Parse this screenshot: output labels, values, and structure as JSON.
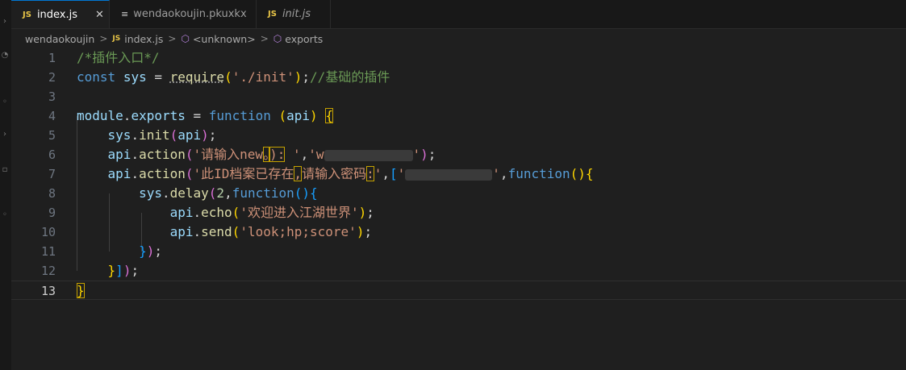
{
  "tabs": [
    {
      "label": "index.js",
      "badge": "JS",
      "active": true,
      "close": "✕"
    },
    {
      "label": "wendaokoujin.pkuxkx",
      "icon": "lines-file-icon"
    },
    {
      "label": "init.js",
      "badge": "JS",
      "italic": true
    }
  ],
  "breadcrumb": {
    "folder": "wendaokoujin",
    "file": "index.js",
    "file_badge": "JS",
    "symbol1": "<unknown>",
    "symbol2": "exports",
    "separator": ">"
  },
  "line_numbers": [
    "1",
    "2",
    "3",
    "4",
    "5",
    "6",
    "7",
    "8",
    "9",
    "10",
    "11",
    "12",
    "13"
  ],
  "code": {
    "l1_comment": "/*插件入口*/",
    "l2_const": "const",
    "l2_sys": "sys",
    "l2_eq": " = ",
    "l2_require": "require",
    "l2_str": "'./init'",
    "l2_semi": ";",
    "l2_comment": "//基础的插件",
    "l4_module": "module",
    "l4_dot": ".",
    "l4_exports": "exports",
    "l4_eq": " = ",
    "l4_function": "function",
    "l4_api": "api",
    "l5_sys": "sys",
    "l5_init": "init",
    "l5_api": "api",
    "l6_api": "api",
    "l6_action": "action",
    "l6_str_a": "'请输入new",
    "l6_str_b": "。",
    "l6_str_c": "):",
    "l6_str_d": " '",
    "l6_str_e": "'w",
    "l6_str_f": "'",
    "l7_api": "api",
    "l7_action": "action",
    "l7_str_a": "'此ID档案已存在",
    "l7_str_b": ",",
    "l7_str_c": "请输入密码",
    "l7_str_d": ":",
    "l7_str_e": "'",
    "l7_str_f": "'",
    "l7_str_g": "'",
    "l7_function": "function",
    "l8_sys": "sys",
    "l8_delay": "delay",
    "l8_num": "2",
    "l8_function": "function",
    "l9_api": "api",
    "l9_echo": "echo",
    "l9_str": "'欢迎进入江湖世界'",
    "l10_api": "api",
    "l10_send": "send",
    "l10_str": "'look;hp;score'"
  }
}
